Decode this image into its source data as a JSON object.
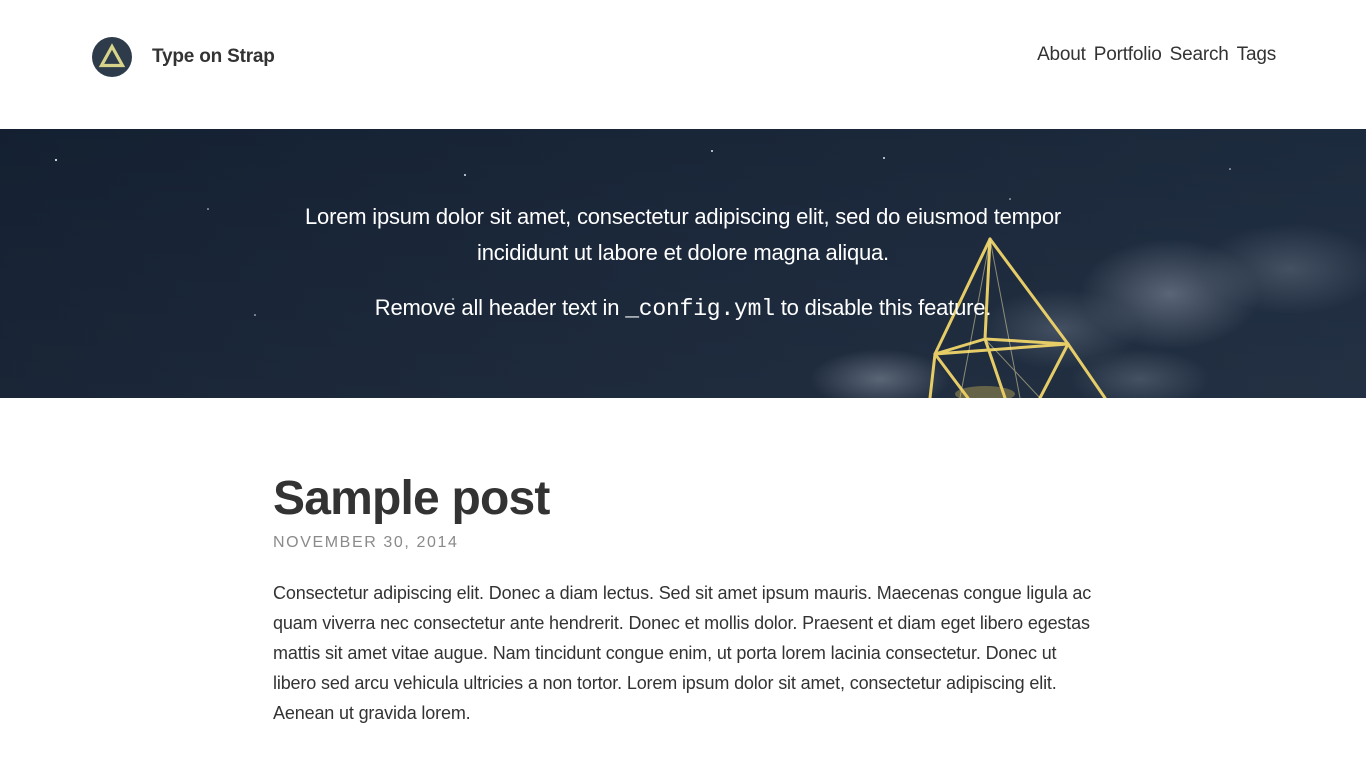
{
  "header": {
    "site_title": "Type on Strap",
    "logo_icon": "triangle-logo-icon",
    "nav": [
      {
        "label": "About"
      },
      {
        "label": "Portfolio"
      },
      {
        "label": "Search"
      },
      {
        "label": "Tags"
      }
    ]
  },
  "hero": {
    "line1": "Lorem ipsum dolor sit amet, consectetur adipiscing elit, sed do eiusmod tempor incididunt ut labore et dolore magna aliqua.",
    "line2_prefix": "Remove all header text in",
    "line2_code": "_config.yml",
    "line2_suffix": "to disable this feature."
  },
  "post": {
    "title": "Sample post",
    "date": "NOVEMBER 30, 2014",
    "body": "Consectetur adipiscing elit. Donec a diam lectus. Sed sit amet ipsum mauris. Maecenas congue ligula ac quam viverra nec consectetur ante hendrerit. Donec et mollis dolor. Praesent et diam eget libero egestas mattis sit amet vitae augue. Nam tincidunt congue enim, ut porta lorem lacinia consectetur. Donec ut libero sed arcu vehicula ultricies a non tortor. Lorem ipsum dolor sit amet, consectetur adipiscing elit. Aenean ut gravida lorem."
  },
  "colors": {
    "text": "#333333",
    "meta": "#8a8a8a",
    "hero_bg": "#1a2638",
    "logo_bg": "#2d3b4a",
    "logo_triangle": "#d7d48a"
  }
}
